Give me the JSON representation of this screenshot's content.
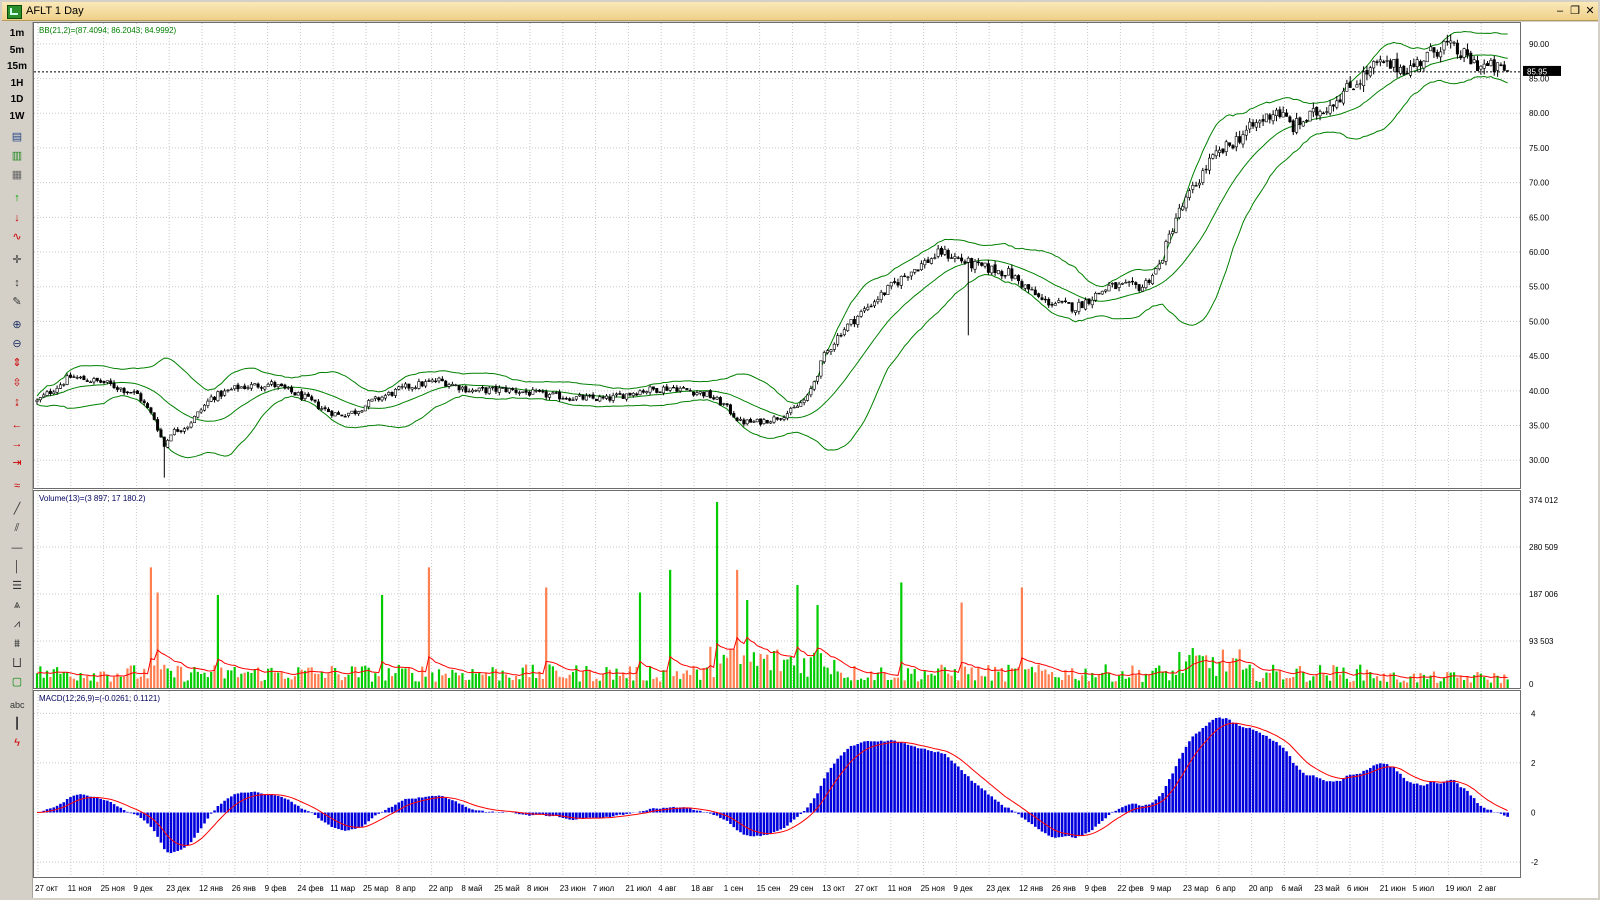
{
  "window": {
    "title": "AFLT 1 Day"
  },
  "toolbar": {
    "timeframes": [
      "1m",
      "5m",
      "15m",
      "1H",
      "1D",
      "1W"
    ],
    "tools": [
      "line-chart-icon",
      "bar-chart-icon",
      "candle-chart-icon",
      "buy-icon",
      "sell-icon",
      "wave-icon",
      "crosshair-icon",
      "cursor-icon",
      "pencil-icon",
      "zoom-in-icon",
      "zoom-out-icon",
      "scale-up-icon",
      "scale-down-icon",
      "fit-icon",
      "scroll-left-icon",
      "scroll-right-icon",
      "scroll-end-icon",
      "indicator-icon",
      "trendline-icon",
      "channel-icon",
      "hline-icon",
      "vline-icon",
      "fibonacci-icon",
      "fan-icon",
      "arc-icon",
      "gann-icon",
      "period-icon",
      "rectangle-icon",
      "text-icon",
      "bars-icon",
      "lightning-icon"
    ],
    "text_tool_label": "abc"
  },
  "panes": {
    "price_label": "BB(21,2)=(87.4094; 86.2043; 84.9992)",
    "volume_label": "Volume(13)=(3 897; 17 180.2)",
    "macd_label": "MACD(12;26,9)=(-0.0261; 0.1121)",
    "last_price": "85.95"
  },
  "colors": {
    "up": "#00cc00",
    "down": "#ff7f50",
    "band": "#008000",
    "macd_bar": "#0000dd",
    "signal": "#ff0000",
    "grid": "#c8c8c8"
  },
  "chart_data": [
    {
      "type": "candlestick",
      "title": "BB(21,2)=(87.4094; 86.2043; 84.9992)",
      "ylim": [
        26,
        93
      ],
      "y_ticks": [
        "30.00",
        "35.00",
        "40.00",
        "45.00",
        "50.00",
        "55.00",
        "60.00",
        "65.00",
        "70.00",
        "75.00",
        "80.00",
        "85.00",
        "90.00"
      ],
      "last_price": 85.95,
      "x_ticks": [
        "27 окт",
        "11 ноя",
        "25 ноя",
        "9 дек",
        "23 дек",
        "12 янв",
        "26 янв",
        "9 фев",
        "24 фев",
        "11 мар",
        "25 мар",
        "8 апр",
        "22 апр",
        "8 май",
        "25 май",
        "8 июн",
        "23 июн",
        "7 июл",
        "21 июл",
        "4 авг",
        "18 авг",
        "1 сен",
        "15 сен",
        "29 сен",
        "13 окт",
        "27 окт",
        "11 ноя",
        "25 ноя",
        "9 дек",
        "23 дек",
        "12 янв",
        "26 янв",
        "9 фев",
        "22 фев",
        "9 мар",
        "23 мар",
        "6 апр",
        "20 апр",
        "6 май",
        "23 май",
        "6 июн",
        "21 июн",
        "5 июл",
        "19 июл",
        "2 авг"
      ],
      "price_path": [
        [
          0,
          38.5
        ],
        [
          10,
          42
        ],
        [
          20,
          41.2
        ],
        [
          30,
          39.5
        ],
        [
          35,
          36
        ],
        [
          38,
          32
        ],
        [
          40,
          34
        ],
        [
          45,
          35
        ],
        [
          52,
          39
        ],
        [
          60,
          40.5
        ],
        [
          70,
          41
        ],
        [
          80,
          39
        ],
        [
          85,
          37.5
        ],
        [
          90,
          36.5
        ],
        [
          95,
          37
        ],
        [
          100,
          38.5
        ],
        [
          110,
          40.5
        ],
        [
          120,
          41.5
        ],
        [
          130,
          40
        ],
        [
          140,
          40.2
        ],
        [
          150,
          39.5
        ],
        [
          160,
          39
        ],
        [
          170,
          38.8
        ],
        [
          180,
          40
        ],
        [
          190,
          40.5
        ],
        [
          200,
          39.5
        ],
        [
          205,
          38
        ],
        [
          210,
          35.5
        ],
        [
          215,
          35.5
        ],
        [
          220,
          36
        ],
        [
          225,
          37
        ],
        [
          230,
          39
        ],
        [
          235,
          45
        ],
        [
          240,
          48.5
        ],
        [
          250,
          53
        ],
        [
          260,
          57
        ],
        [
          270,
          60
        ],
        [
          280,
          58
        ],
        [
          290,
          57
        ],
        [
          300,
          53
        ],
        [
          310,
          52
        ],
        [
          320,
          55
        ],
        [
          330,
          55
        ],
        [
          335,
          58
        ],
        [
          340,
          65
        ],
        [
          350,
          73
        ],
        [
          360,
          77
        ],
        [
          370,
          80.5
        ],
        [
          375,
          78
        ],
        [
          385,
          81
        ],
        [
          395,
          85
        ],
        [
          400,
          87
        ],
        [
          410,
          86.5
        ],
        [
          420,
          90
        ],
        [
          430,
          87
        ],
        [
          440,
          86
        ]
      ],
      "bb": {
        "period": 21,
        "k": 2
      },
      "n_bars": 440
    },
    {
      "type": "bar",
      "title": "Volume(13)=(3 897; 17 180.2)",
      "ylim": [
        0,
        380000
      ],
      "y_ticks": [
        "0",
        "93 503",
        "187 006",
        "280 509",
        "374 012"
      ],
      "spikes": [
        [
          34,
          240000
        ],
        [
          36,
          190000
        ],
        [
          54,
          185000
        ],
        [
          103,
          185000
        ],
        [
          117,
          240000
        ],
        [
          152,
          200000
        ],
        [
          180,
          190000
        ],
        [
          189,
          235000
        ],
        [
          203,
          370000
        ],
        [
          209,
          235000
        ],
        [
          212,
          175000
        ],
        [
          227,
          205000
        ],
        [
          233,
          165000
        ],
        [
          258,
          210000
        ],
        [
          276,
          170000
        ],
        [
          294,
          200000
        ]
      ]
    },
    {
      "type": "bar",
      "title": "MACD(12;26,9)=(-0.0261; 0.1121)",
      "ylim": [
        -2.6,
        4.9
      ],
      "y_ticks": [
        "-2",
        "0",
        "2",
        "4"
      ]
    }
  ]
}
